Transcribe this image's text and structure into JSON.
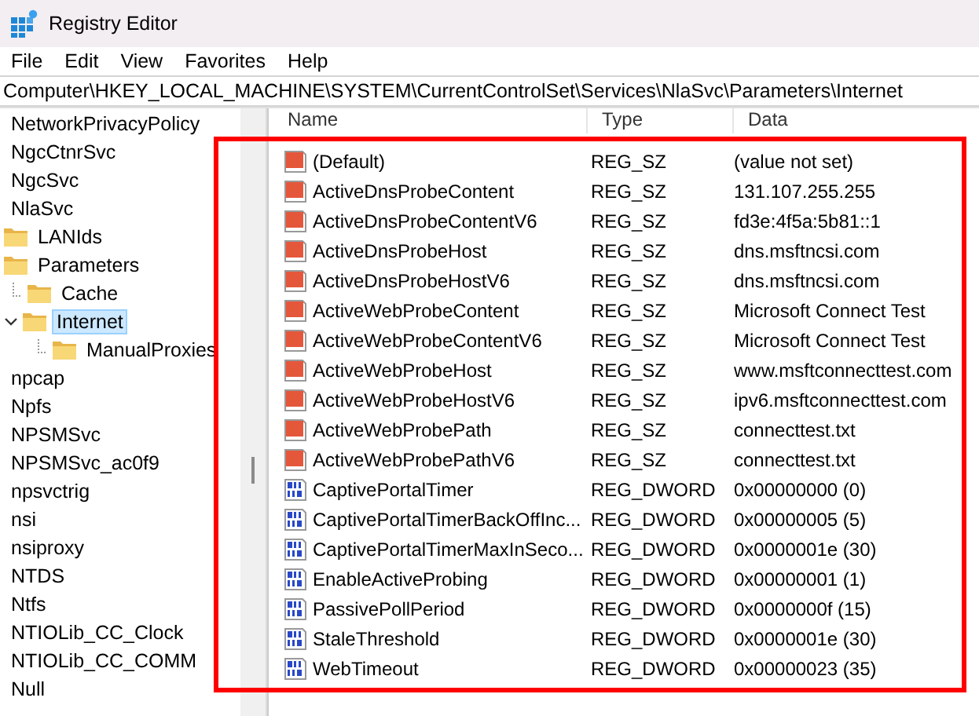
{
  "window": {
    "title": "Registry Editor"
  },
  "menu": [
    "File",
    "Edit",
    "View",
    "Favorites",
    "Help"
  ],
  "address": {
    "value": "Computer\\HKEY_LOCAL_MACHINE\\SYSTEM\\CurrentControlSet\\Services\\NlaSvc\\Parameters\\Internet"
  },
  "tree": [
    {
      "label": "NetworkPrivacyPolicy",
      "selected": false
    },
    {
      "label": "NgcCtnrSvc",
      "selected": false
    },
    {
      "label": "NgcSvc",
      "selected": false
    },
    {
      "label": "NlaSvc",
      "selected": false,
      "children": [
        {
          "label": "LANIds",
          "selected": false
        },
        {
          "label": "Parameters",
          "selected": false,
          "children": [
            {
              "label": "Cache",
              "selected": false
            },
            {
              "label": "Internet",
              "selected": true,
              "expanded": true,
              "children": [
                {
                  "label": "ManualProxies",
                  "selected": false
                }
              ]
            }
          ]
        }
      ]
    },
    {
      "label": "npcap",
      "selected": false
    },
    {
      "label": "Npfs",
      "selected": false
    },
    {
      "label": "NPSMSvc",
      "selected": false
    },
    {
      "label": "NPSMSvc_ac0f9",
      "selected": false
    },
    {
      "label": "npsvctrig",
      "selected": false
    },
    {
      "label": "nsi",
      "selected": false
    },
    {
      "label": "nsiproxy",
      "selected": false
    },
    {
      "label": "NTDS",
      "selected": false
    },
    {
      "label": "Ntfs",
      "selected": false
    },
    {
      "label": "NTIOLib_CC_Clock",
      "selected": false
    },
    {
      "label": "NTIOLib_CC_COMM",
      "selected": false
    },
    {
      "label": "Null",
      "selected": false
    }
  ],
  "values": {
    "columns": [
      "Name",
      "Type",
      "Data"
    ],
    "rows": [
      {
        "kind": "string",
        "name": "(Default)",
        "type": "REG_SZ",
        "data": "(value not set)"
      },
      {
        "kind": "string",
        "name": "ActiveDnsProbeContent",
        "type": "REG_SZ",
        "data": "131.107.255.255"
      },
      {
        "kind": "string",
        "name": "ActiveDnsProbeContentV6",
        "type": "REG_SZ",
        "data": "fd3e:4f5a:5b81::1"
      },
      {
        "kind": "string",
        "name": "ActiveDnsProbeHost",
        "type": "REG_SZ",
        "data": "dns.msftncsi.com"
      },
      {
        "kind": "string",
        "name": "ActiveDnsProbeHostV6",
        "type": "REG_SZ",
        "data": "dns.msftncsi.com"
      },
      {
        "kind": "string",
        "name": "ActiveWebProbeContent",
        "type": "REG_SZ",
        "data": "Microsoft Connect Test"
      },
      {
        "kind": "string",
        "name": "ActiveWebProbeContentV6",
        "type": "REG_SZ",
        "data": "Microsoft Connect Test"
      },
      {
        "kind": "string",
        "name": "ActiveWebProbeHost",
        "type": "REG_SZ",
        "data": "www.msftconnecttest.com"
      },
      {
        "kind": "string",
        "name": "ActiveWebProbeHostV6",
        "type": "REG_SZ",
        "data": "ipv6.msftconnecttest.com"
      },
      {
        "kind": "string",
        "name": "ActiveWebProbePath",
        "type": "REG_SZ",
        "data": "connecttest.txt"
      },
      {
        "kind": "string",
        "name": "ActiveWebProbePathV6",
        "type": "REG_SZ",
        "data": "connecttest.txt"
      },
      {
        "kind": "dword",
        "name": "CaptivePortalTimer",
        "type": "REG_DWORD",
        "data": "0x00000000 (0)"
      },
      {
        "kind": "dword",
        "name": "CaptivePortalTimerBackOffInc...",
        "type": "REG_DWORD",
        "data": "0x00000005 (5)"
      },
      {
        "kind": "dword",
        "name": "CaptivePortalTimerMaxInSeco...",
        "type": "REG_DWORD",
        "data": "0x0000001e (30)"
      },
      {
        "kind": "dword",
        "name": "EnableActiveProbing",
        "type": "REG_DWORD",
        "data": "0x00000001 (1)"
      },
      {
        "kind": "dword",
        "name": "PassivePollPeriod",
        "type": "REG_DWORD",
        "data": "0x0000000f (15)"
      },
      {
        "kind": "dword",
        "name": "StaleThreshold",
        "type": "REG_DWORD",
        "data": "0x0000001e (30)"
      },
      {
        "kind": "dword",
        "name": "WebTimeout",
        "type": "REG_DWORD",
        "data": "0x00000023 (35)"
      }
    ]
  },
  "annotations": [
    {
      "kind": "rectangle"
    }
  ]
}
